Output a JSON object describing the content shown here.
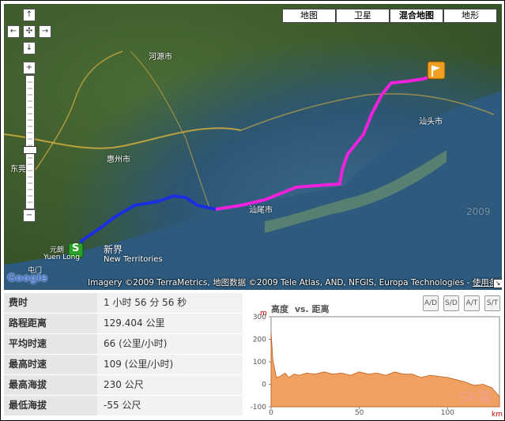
{
  "map": {
    "type_buttons": [
      {
        "label": "地图",
        "selected": false
      },
      {
        "label": "卫星",
        "selected": false
      },
      {
        "label": "混合地图",
        "selected": true
      },
      {
        "label": "地形",
        "selected": false
      }
    ],
    "place_labels": [
      "河源市",
      "惠州市",
      "东莞",
      "汕尾市",
      "汕头市",
      "新界",
      "New Territories",
      "元朗",
      "Yuen Long",
      "屯门",
      "2009"
    ],
    "route_colors": {
      "start_segment": "#1a2fe0",
      "end_segment": "#ee22dd"
    },
    "start_marker": "S",
    "copyright": "Imagery ©2009 TerraMetrics, 地图数据 ©2009 Tele Atlas, AND, NFGIS, Europa Technologies - ",
    "terms_link": "使用条款"
  },
  "stats": [
    {
      "label": "费时",
      "value": "1 小时  56 分  56 秒"
    },
    {
      "label": "路程距离",
      "value": "129.404 公里"
    },
    {
      "label": "平均时速",
      "value": "66 (公里/小时)"
    },
    {
      "label": "最高时速",
      "value": "109 (公里/小时)"
    },
    {
      "label": "最高海拔",
      "value": "230 公尺"
    },
    {
      "label": "最低海拔",
      "value": "-55 公尺"
    }
  ],
  "elevation": {
    "title": "高度",
    "vs_label": "vs. 距离",
    "buttons": [
      "A/D",
      "S/D",
      "A/T",
      "S/T"
    ],
    "y_unit": "m",
    "x_unit": "km",
    "fill_color": "#f0a060",
    "watermark": "SK猫",
    "chart_data": {
      "type": "area",
      "title": "高度 vs. 距离",
      "ylabel": "m",
      "xlabel": "km",
      "ylim": [
        -100,
        300
      ],
      "xlim": [
        0,
        129.4
      ],
      "yticks": [
        -100,
        0,
        100,
        200,
        300
      ],
      "xticks": [
        0,
        50,
        100
      ],
      "x": [
        0,
        1,
        3,
        5,
        8,
        10,
        13,
        16,
        20,
        25,
        30,
        35,
        40,
        45,
        50,
        55,
        60,
        65,
        70,
        75,
        80,
        85,
        90,
        95,
        100,
        105,
        110,
        115,
        120,
        125,
        129.4
      ],
      "values": [
        230,
        110,
        30,
        35,
        50,
        30,
        45,
        40,
        50,
        45,
        55,
        45,
        50,
        40,
        55,
        45,
        50,
        40,
        55,
        45,
        45,
        30,
        40,
        35,
        30,
        20,
        10,
        -5,
        0,
        -15,
        -55
      ]
    }
  }
}
